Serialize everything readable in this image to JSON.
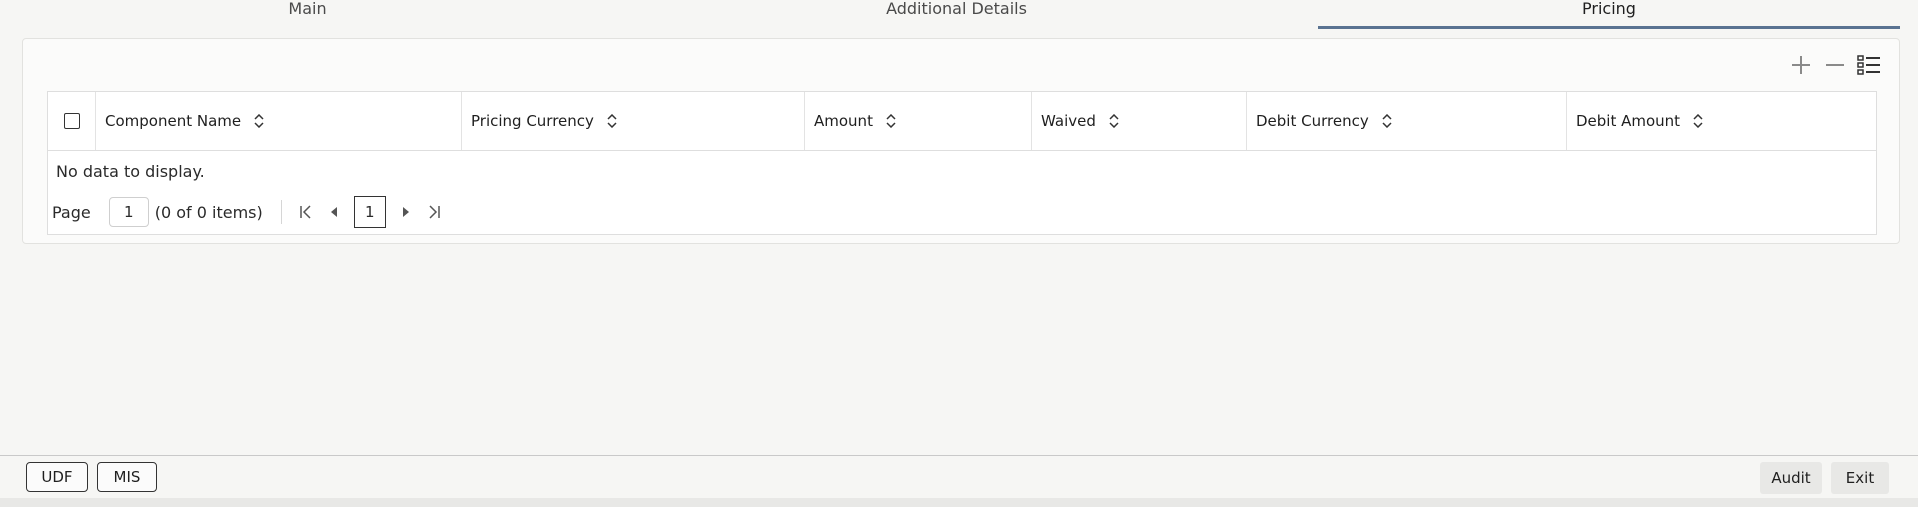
{
  "tabs": [
    {
      "label": "Main",
      "active": false
    },
    {
      "label": "Additional Details",
      "active": false
    },
    {
      "label": "Pricing",
      "active": true
    }
  ],
  "toolbar": {
    "icons": [
      "add-icon",
      "remove-icon",
      "column-list-icon"
    ]
  },
  "table": {
    "columns": [
      {
        "label": "Component Name",
        "width": 366
      },
      {
        "label": "Pricing Currency",
        "width": 343
      },
      {
        "label": "Amount",
        "width": 227
      },
      {
        "label": "Waived",
        "width": 215
      },
      {
        "label": "Debit Currency",
        "width": 320
      },
      {
        "label": "Debit Amount",
        "width": 308
      }
    ],
    "empty_text": "No data to display."
  },
  "pager": {
    "page_label": "Page",
    "page_value": "1",
    "items_text": "(0 of 0 items)",
    "current_page": "1"
  },
  "footer": {
    "udf_label": "UDF",
    "mis_label": "MIS",
    "audit_label": "Audit",
    "exit_label": "Exit"
  },
  "colors": {
    "active_tab_underline": "#5a7391",
    "background": "#f6f6f4"
  }
}
